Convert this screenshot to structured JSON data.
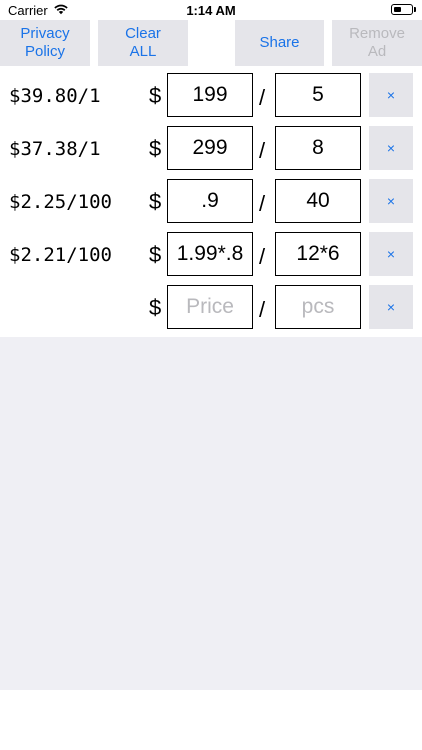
{
  "status_bar": {
    "carrier": "Carrier",
    "time": "1:14 AM",
    "battery_level": 0.45,
    "wifi_icon": "wifi-icon"
  },
  "toolbar": {
    "privacy_label": "Privacy\nPolicy",
    "clear_label": "Clear\nALL",
    "share_label": "Share",
    "remove_ad_label": "Remove\nAd"
  },
  "rows": [
    {
      "unit_price": "$39.80/1",
      "currency": "$",
      "price": "199",
      "separator": "/",
      "pcs": "5",
      "delete": "×"
    },
    {
      "unit_price": "$37.38/1",
      "currency": "$",
      "price": "299",
      "separator": "/",
      "pcs": "8",
      "delete": "×"
    },
    {
      "unit_price": "$2.25/100",
      "currency": "$",
      "price": ".9",
      "separator": "/",
      "pcs": "40",
      "delete": "×"
    },
    {
      "unit_price": "$2.21/100",
      "currency": "$",
      "price": "1.99*.8",
      "separator": "/",
      "pcs": "12*6",
      "delete": "×"
    }
  ],
  "new_row": {
    "currency": "$",
    "price_placeholder": "Price",
    "separator": "/",
    "pcs_placeholder": "pcs",
    "delete": "×"
  },
  "colors": {
    "accent": "#1a73e8",
    "button_bg": "#e5e5ea",
    "disabled_text": "#b9b9bd",
    "empty_bg": "#efeff4"
  }
}
